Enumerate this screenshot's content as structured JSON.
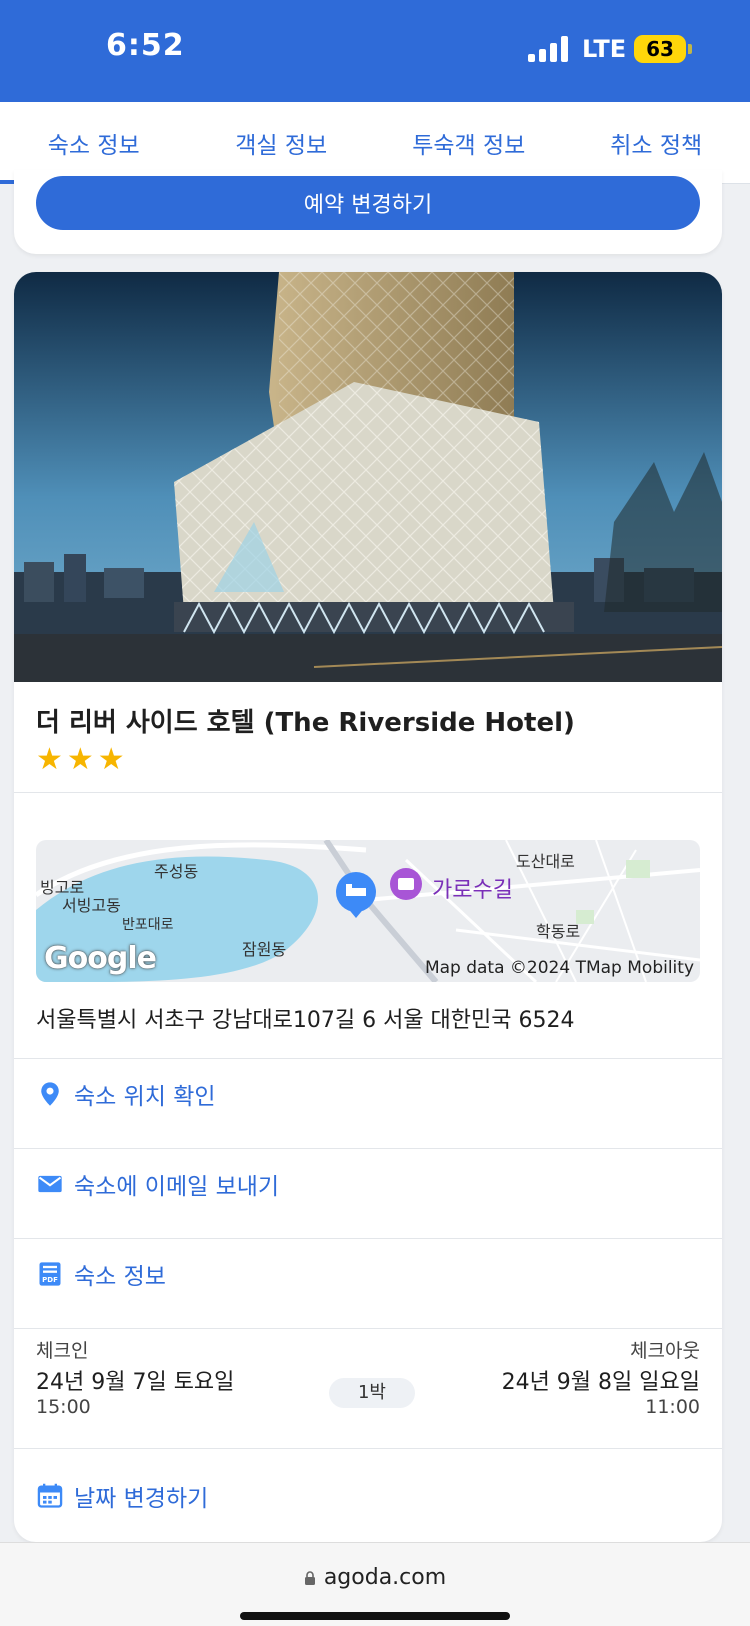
{
  "status": {
    "time": "6:52",
    "network": "LTE",
    "battery": "63"
  },
  "tabs": [
    {
      "label": "숙소 정보",
      "active": true
    },
    {
      "label": "객실 정보",
      "active": false
    },
    {
      "label": "투숙객 정보",
      "active": false
    },
    {
      "label": "취소 정책",
      "active": false
    }
  ],
  "booking": {
    "change_button": "예약 변경하기"
  },
  "hotel": {
    "name": "더 리버 사이드 호텔 (The Riverside Hotel)",
    "stars": 3,
    "stars_text": "★★★",
    "address": "서울특별시 서초구 강남대로107길 6 서울 대한민국 6524"
  },
  "map": {
    "attribution": "Map data ©2024 TMap Mobility",
    "logo": "Google",
    "labels": {
      "l1": "빙고로",
      "l2": "주성동",
      "l3": "서빙고동",
      "l4": "도산대로",
      "l5": "가로수길",
      "l6": "학동로",
      "l7": "잠원동",
      "l8": "반포대로"
    }
  },
  "links": {
    "location": "숙소 위치 확인",
    "email": "숙소에 이메일 보내기",
    "info": "숙소 정보"
  },
  "stay": {
    "checkin_label": "체크인",
    "checkin_date": "24년 9월 7일 토요일",
    "checkin_time": "15:00",
    "nights": "1박",
    "checkout_label": "체크아웃",
    "checkout_date": "24년 9월 8일 일요일",
    "checkout_time": "11:00",
    "change_dates": "날짜 변경하기"
  },
  "browser": {
    "url": "agoda.com"
  },
  "colors": {
    "brand": "#2f6bd8",
    "star": "#f7b500",
    "battery": "#ffd60a"
  }
}
